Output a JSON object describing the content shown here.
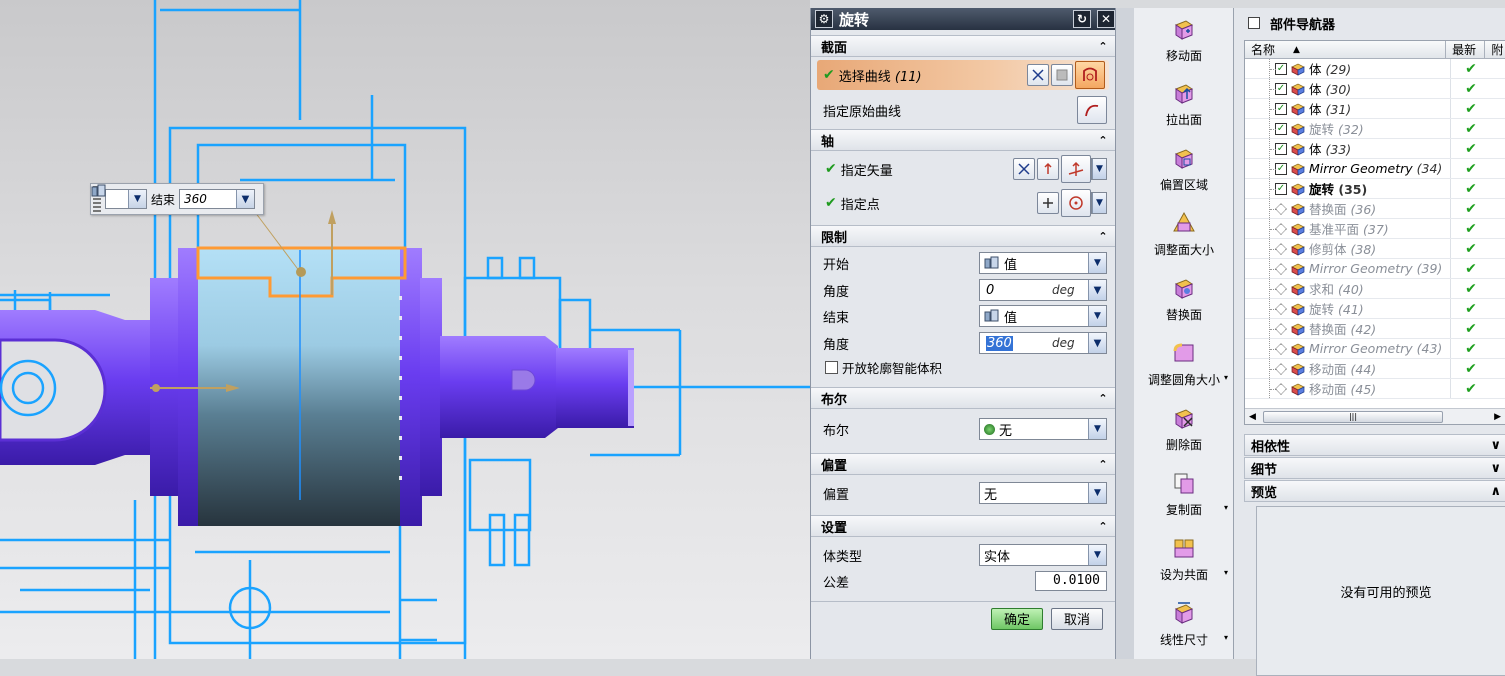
{
  "floating_bar": {
    "label": "结束",
    "value": "360"
  },
  "dialog": {
    "title": "旋转",
    "sections": {
      "section": {
        "title": "截面",
        "select_curve": "选择曲线",
        "select_curve_count": "(11)",
        "specify_origin_curve": "指定原始曲线"
      },
      "axis": {
        "title": "轴",
        "specify_vector": "指定矢量",
        "specify_point": "指定点"
      },
      "limits": {
        "title": "限制",
        "start_label": "开始",
        "start_option": "值",
        "start_angle_label": "角度",
        "start_angle": "0",
        "end_label": "结束",
        "end_option": "值",
        "end_angle_label": "角度",
        "end_angle": "360",
        "unit": "deg",
        "open_profile": "开放轮廓智能体积"
      },
      "boolean": {
        "title": "布尔",
        "label": "布尔",
        "value": "无"
      },
      "offset": {
        "title": "偏置",
        "label": "偏置",
        "value": "无"
      },
      "settings": {
        "title": "设置",
        "body_type_label": "体类型",
        "body_type": "实体",
        "tolerance_label": "公差",
        "tolerance": "0.0100"
      }
    },
    "ok": "确定",
    "cancel": "取消"
  },
  "toolbar": [
    {
      "label": "移动面",
      "icon": "move-face-icon"
    },
    {
      "label": "拉出面",
      "icon": "pull-face-icon"
    },
    {
      "label": "偏置区域",
      "icon": "offset-region-icon"
    },
    {
      "label": "调整面大小",
      "icon": "resize-face-icon"
    },
    {
      "label": "替换面",
      "icon": "replace-face-icon"
    },
    {
      "label": "调整圆角大小",
      "icon": "resize-blend-icon"
    },
    {
      "label": "删除面",
      "icon": "delete-face-icon"
    },
    {
      "label": "复制面",
      "icon": "copy-face-icon"
    },
    {
      "label": "设为共面",
      "icon": "make-coplanar-icon"
    },
    {
      "label": "线性尺寸",
      "icon": "linear-dimension-icon"
    }
  ],
  "navigator": {
    "title": "部件导航器",
    "columns": {
      "name": "名称",
      "latest": "最新",
      "attach": "附"
    },
    "rows": [
      {
        "name": "体",
        "num": "(29)",
        "style": "normal",
        "checked": true
      },
      {
        "name": "体",
        "num": "(30)",
        "style": "normal",
        "checked": true
      },
      {
        "name": "体",
        "num": "(31)",
        "style": "normal",
        "checked": true
      },
      {
        "name": "旋转",
        "num": "(32)",
        "style": "dim",
        "checked": true
      },
      {
        "name": "体",
        "num": "(33)",
        "style": "normal",
        "checked": true
      },
      {
        "name": "Mirror Geometry",
        "num": "(34)",
        "style": "italic",
        "checked": true
      },
      {
        "name": "旋转",
        "num": "(35)",
        "style": "bold",
        "checked": true
      },
      {
        "name": "替换面",
        "num": "(36)",
        "style": "dim",
        "checked": false
      },
      {
        "name": "基准平面",
        "num": "(37)",
        "style": "dim",
        "checked": false
      },
      {
        "name": "修剪体",
        "num": "(38)",
        "style": "dim",
        "checked": false
      },
      {
        "name": "Mirror Geometry",
        "num": "(39)",
        "style": "dim",
        "checked": false
      },
      {
        "name": "求和",
        "num": "(40)",
        "style": "dim",
        "checked": false
      },
      {
        "name": "旋转",
        "num": "(41)",
        "style": "dim",
        "checked": false
      },
      {
        "name": "替换面",
        "num": "(42)",
        "style": "dim",
        "checked": false
      },
      {
        "name": "Mirror Geometry",
        "num": "(43)",
        "style": "dim",
        "checked": false
      },
      {
        "name": "移动面",
        "num": "(44)",
        "style": "dim",
        "checked": false
      },
      {
        "name": "移动面",
        "num": "(45)",
        "style": "dim",
        "checked": false
      }
    ],
    "dependencies": "相依性",
    "details": "细节",
    "preview": "预览",
    "no_preview": "没有可用的预览"
  }
}
